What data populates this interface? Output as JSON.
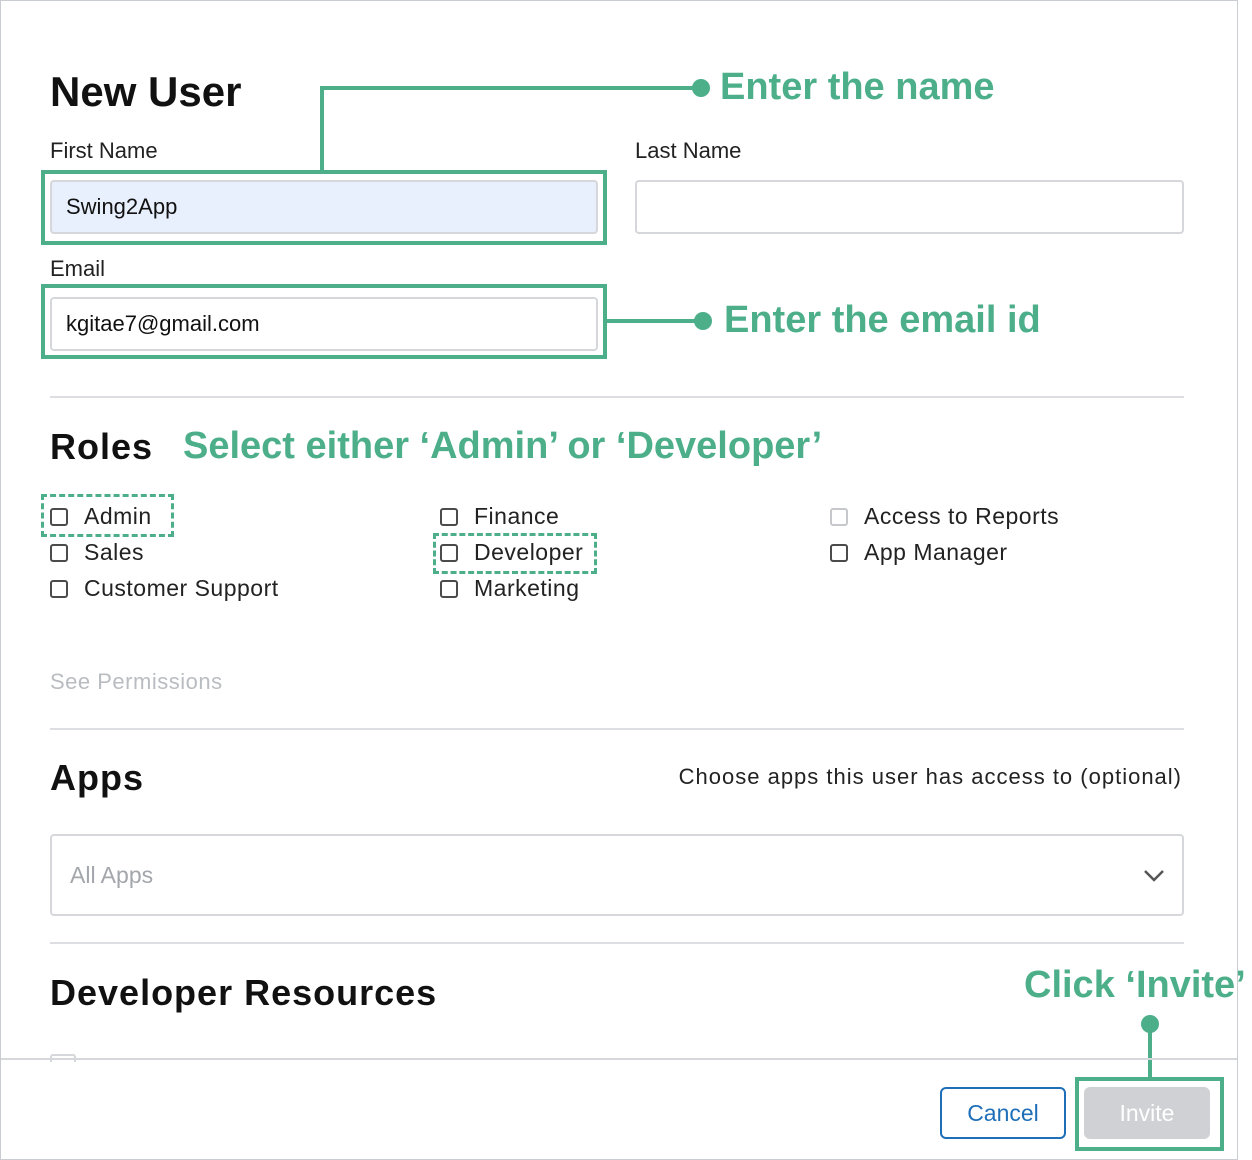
{
  "dialog": {
    "title": "New User",
    "first_name_label": "First Name",
    "first_name_value": "Swing2App",
    "last_name_label": "Last Name",
    "last_name_value": "",
    "email_label": "Email",
    "email_value": "kgitae7@gmail.com"
  },
  "roles": {
    "heading": "Roles",
    "items": [
      {
        "label": "Admin",
        "checked": false
      },
      {
        "label": "Sales",
        "checked": false
      },
      {
        "label": "Customer Support",
        "checked": false
      },
      {
        "label": "Finance",
        "checked": false
      },
      {
        "label": "Developer",
        "checked": false
      },
      {
        "label": "Marketing",
        "checked": false
      },
      {
        "label": "Access to Reports",
        "checked": false,
        "disabled": true
      },
      {
        "label": "App Manager",
        "checked": false
      }
    ],
    "see_permissions": "See Permissions"
  },
  "apps": {
    "heading": "Apps",
    "hint": "Choose apps this user has access to (optional)",
    "selected": "All Apps"
  },
  "developer_resources": {
    "heading": "Developer Resources"
  },
  "footer": {
    "cancel_label": "Cancel",
    "invite_label": "Invite"
  },
  "annotations": {
    "name": "Enter the name",
    "email": "Enter the email id",
    "roles": "Select either ‘Admin’ or ‘Developer’",
    "invite": "Click ‘Invite’"
  },
  "colors": {
    "annotation": "#4caf8a",
    "link": "#1f6fb8",
    "input_filled": "#e8f0fd",
    "disabled_button": "#cfd1d4"
  }
}
